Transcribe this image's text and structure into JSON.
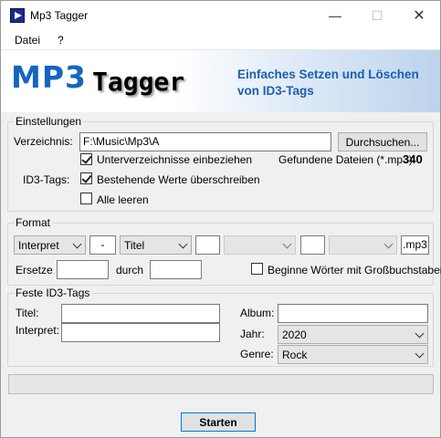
{
  "window": {
    "title": "Mp3 Tagger",
    "minimize_glyph": "—",
    "maximize_glyph": "☐",
    "close_glyph": "✕"
  },
  "menu": {
    "items": [
      "Datei",
      "?"
    ]
  },
  "banner": {
    "logo_part1": "MP3",
    "logo_part2": "Tagger",
    "slogan_line1": "Einfaches Setzen und Löschen",
    "slogan_line2": "von ID3-Tags"
  },
  "einstellungen": {
    "legend": "Einstellungen",
    "directory_label": "Verzeichnis:",
    "directory_value": "F:\\Music\\Mp3\\A",
    "browse_label": "Durchsuchen...",
    "include_subdirs_label": "Unterverzeichnisse einbeziehen",
    "include_subdirs_checked": true,
    "found_files_label": "Gefundene Dateien (*.mp3):",
    "found_files_count": "340",
    "id3_label": "ID3-Tags:",
    "overwrite_label": "Bestehende Werte überschreiben",
    "overwrite_checked": true,
    "clear_all_label": "Alle leeren",
    "clear_all_checked": false
  },
  "format": {
    "legend": "Format",
    "field1": "Interpret",
    "separator1": "-",
    "field2": "Titel",
    "separator2": "",
    "field3": "",
    "separator3": "",
    "field4": "",
    "extension": ".mp3",
    "replace_label": "Ersetze",
    "replace_value": "",
    "with_label": "durch",
    "with_value": "",
    "capitalize_label": "Beginne Wörter mit Großbuchstaben",
    "capitalize_checked": false
  },
  "fixed_tags": {
    "legend": "Feste ID3-Tags",
    "title_label": "Titel:",
    "title_value": "",
    "artist_label": "Interpret:",
    "artist_value": "",
    "album_label": "Album:",
    "album_value": "",
    "year_label": "Jahr:",
    "year_value": "2020",
    "genre_label": "Genre:",
    "genre_value": "Rock"
  },
  "actions": {
    "start_label": "Starten"
  },
  "colors": {
    "accent_blue": "#1565c0",
    "slogan_blue": "#1a5fb4",
    "focus_border": "#0078d7"
  }
}
